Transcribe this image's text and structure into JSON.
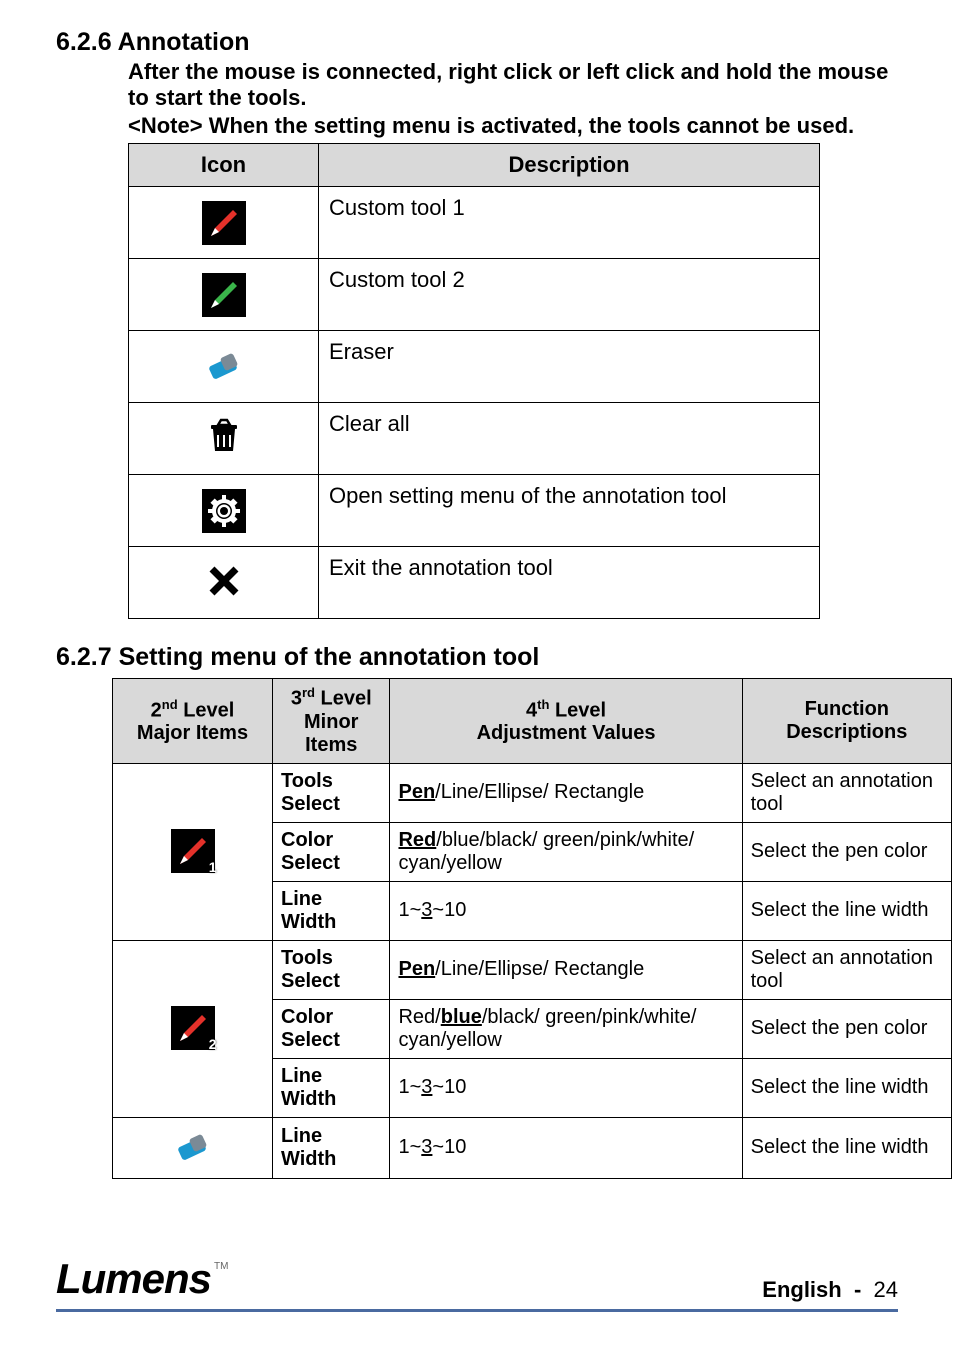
{
  "sections": {
    "annotation": {
      "heading_num": "6.2.6",
      "heading": "Annotation",
      "intro": "After the mouse is connected, right click or left click and hold the mouse to start the tools.",
      "note": "<Note> When the setting menu is activated, the tools cannot be used.",
      "table": {
        "head_icon": "Icon",
        "head_desc": "Description",
        "rows": [
          {
            "desc": "Custom tool 1"
          },
          {
            "desc": "Custom tool 2"
          },
          {
            "desc": "Eraser"
          },
          {
            "desc": "Clear all"
          },
          {
            "desc": "Open setting menu of the annotation tool"
          },
          {
            "desc": "Exit the annotation tool"
          }
        ]
      }
    },
    "settingmenu": {
      "heading_num": "6.2.7",
      "heading": "Setting menu of the annotation tool",
      "table": {
        "head_1_l1": "2",
        "head_1_sup": "nd",
        "head_1_l2": "Level",
        "head_1_b": "Major Items",
        "head_2_l1": "3",
        "head_2_sup": "rd",
        "head_2_l2": "Level",
        "head_2_b": "Minor Items",
        "head_3_l1": "4",
        "head_3_sup": "th",
        "head_3_l2": "Level",
        "head_3_b": "Adjustment Values",
        "head_4": "Function Descriptions",
        "rows": [
          {
            "minor": "Tools Select",
            "adj_pre": "Pen",
            "adj_post": "/Line/Ellipse/ Rectangle",
            "func": "Select an annotation tool"
          },
          {
            "minor": "Color Select",
            "adj_pre": "Red",
            "adj_post": "/blue/black/ green/pink/white/ cyan/yellow",
            "func": "Select the pen color"
          },
          {
            "minor": "Line Width",
            "adj_a": "1~",
            "adj_mid": "3",
            "adj_b": "~10",
            "func": "Select the line width"
          },
          {
            "minor": "Tools Select",
            "adj_pre": "Pen",
            "adj_post": "/Line/Ellipse/ Rectangle",
            "func": "Select an annotation tool"
          },
          {
            "minor": "Color Select",
            "adj_a": "Red/",
            "adj_mid": "blue",
            "adj_b": "/black/ green/pink/white/ cyan/yellow",
            "func": "Select the pen color"
          },
          {
            "minor": "Line Width",
            "adj_a": "1~",
            "adj_mid": "3",
            "adj_b": "~10",
            "func": "Select the line width"
          },
          {
            "minor": "Line Width",
            "adj_a": "1~",
            "adj_mid": "3",
            "adj_b": "~10",
            "func": "Select the line width"
          }
        ]
      }
    }
  },
  "footer": {
    "brand": "Lumens",
    "tm": "TM",
    "lang": "English",
    "dash": "-",
    "page": "24"
  }
}
